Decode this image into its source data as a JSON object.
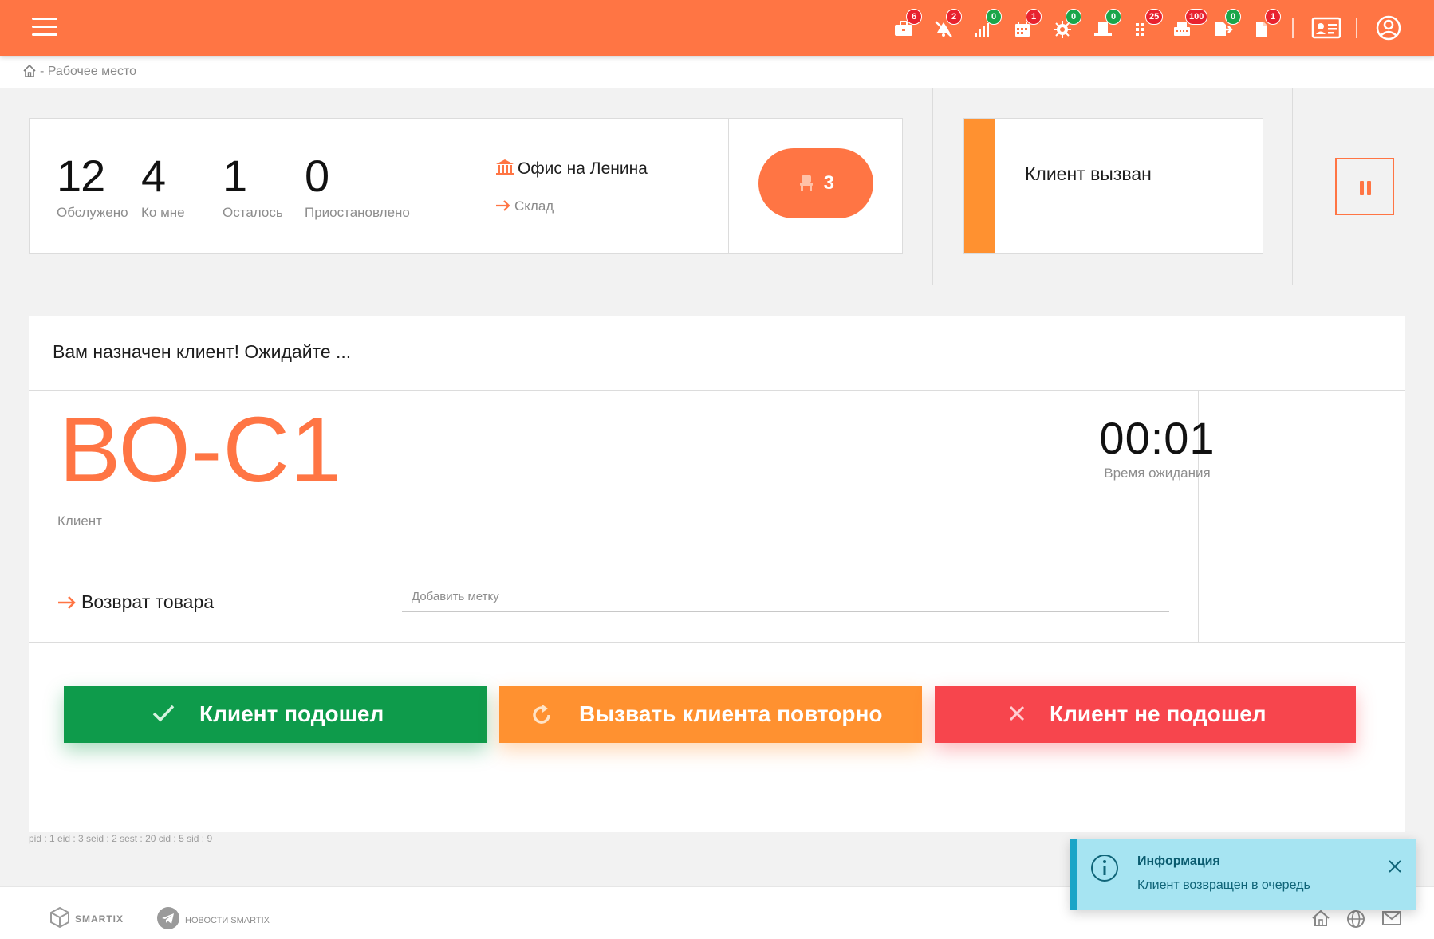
{
  "topbar": {
    "accent": "#ff7544",
    "badge_red": "#e8232f",
    "badge_green": "#1aa64a",
    "icons": [
      {
        "name": "briefcase-icon",
        "badge": "6",
        "color": "red"
      },
      {
        "name": "muted-notification-icon",
        "badge": "2",
        "color": "red"
      },
      {
        "name": "signal-icon",
        "badge": "0",
        "color": "green"
      },
      {
        "name": "calendar-icon",
        "badge": "1",
        "color": "red"
      },
      {
        "name": "chip-icon",
        "badge": "0",
        "color": "green"
      },
      {
        "name": "desk-icon",
        "badge": "0",
        "color": "green"
      },
      {
        "name": "grid-icon",
        "badge": "25",
        "color": "red"
      },
      {
        "name": "printer-icon",
        "badge": "100",
        "color": "red"
      },
      {
        "name": "export-icon",
        "badge": "0",
        "color": "green"
      },
      {
        "name": "document-icon",
        "badge": "1",
        "color": "red"
      }
    ]
  },
  "breadcrumb": {
    "text": "- Рабочее место"
  },
  "stats": [
    {
      "value": "12",
      "label": "Обслужено"
    },
    {
      "value": "4",
      "label": "Ко мне"
    },
    {
      "value": "1",
      "label": "Осталось"
    },
    {
      "value": "0",
      "label": "Приостановлено"
    }
  ],
  "location": {
    "office": "Офис на Ленина",
    "department": "Склад"
  },
  "queue": {
    "count": "3"
  },
  "status": {
    "text": "Клиент вызван",
    "color": "#ff9130"
  },
  "main": {
    "title": "Вам назначен клиент! Ожидайте ...",
    "ticket": "ВО-С1",
    "ticket_label": "Клиент",
    "service": "Возврат товара",
    "tag_placeholder": "Добавить метку",
    "timer": "00:01",
    "timer_label": "Время ожидания"
  },
  "actions": {
    "arrived": "Клиент подошел",
    "recall": "Вызвать клиента повторно",
    "no_show": "Клиент не подошел"
  },
  "debug": "pid : 1  eid : 3  seid : 2  sest : 20  cid : 5  sid : 9",
  "footer": {
    "logo": "SMARTIX",
    "news": "НОВОСТИ SMARTIX"
  },
  "toast": {
    "title": "Информация",
    "message": "Клиент возвращен в очередь"
  }
}
